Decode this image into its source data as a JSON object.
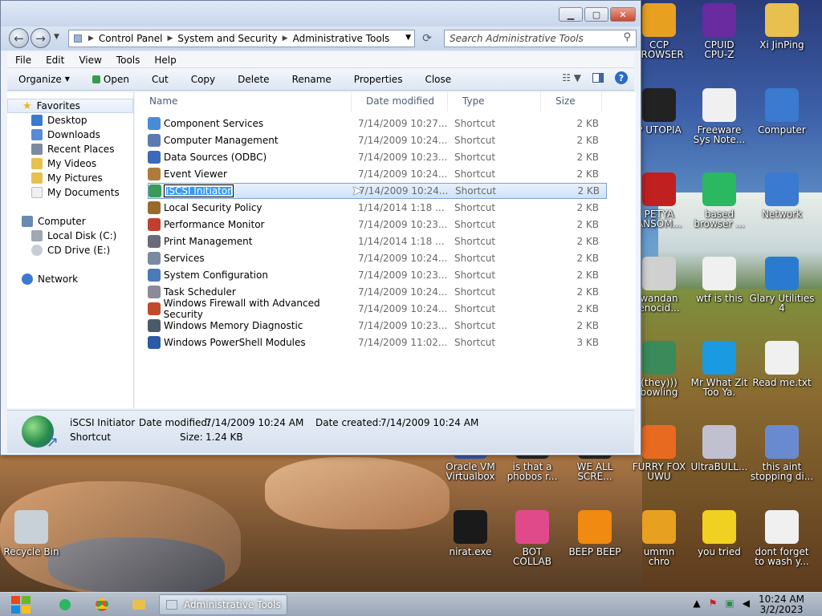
{
  "window": {
    "address": [
      "Control Panel",
      "System and Security",
      "Administrative Tools"
    ],
    "search_placeholder": "Search Administrative Tools"
  },
  "menu": [
    "File",
    "Edit",
    "View",
    "Tools",
    "Help"
  ],
  "toolbar": {
    "organize": "Organize",
    "open": "Open",
    "cut": "Cut",
    "copy": "Copy",
    "delete": "Delete",
    "rename": "Rename",
    "properties": "Properties",
    "close": "Close"
  },
  "nav": {
    "favorites": "Favorites",
    "desktop": "Desktop",
    "downloads": "Downloads",
    "recent": "Recent Places",
    "videos": "My Videos",
    "pictures": "My Pictures",
    "documents": "My Documents",
    "computer": "Computer",
    "localdisk": "Local Disk (C:)",
    "cddrive": "CD Drive (E:)",
    "network": "Network"
  },
  "columns": {
    "name": "Name",
    "date": "Date modified",
    "type": "Type",
    "size": "Size"
  },
  "files": [
    {
      "name": "Component Services",
      "date": "7/14/2009 10:27...",
      "type": "Shortcut",
      "size": "2 KB",
      "icon": "gear-icon",
      "color": "#4a8ad8"
    },
    {
      "name": "Computer Management",
      "date": "7/14/2009 10:24...",
      "type": "Shortcut",
      "size": "2 KB",
      "icon": "computer-icon",
      "color": "#5a7ab0"
    },
    {
      "name": "Data Sources (ODBC)",
      "date": "7/14/2009 10:23...",
      "type": "Shortcut",
      "size": "2 KB",
      "icon": "database-icon",
      "color": "#3a6ab8"
    },
    {
      "name": "Event Viewer",
      "date": "7/14/2009 10:24...",
      "type": "Shortcut",
      "size": "2 KB",
      "icon": "event-log-icon",
      "color": "#b07a3a"
    },
    {
      "name": "iSCSI Initiator",
      "date": "7/14/2009 10:24...",
      "type": "Shortcut",
      "size": "2 KB",
      "icon": "globe-icon",
      "color": "#3a9a5a"
    },
    {
      "name": "Local Security Policy",
      "date": "1/14/2014 1:18 ...",
      "type": "Shortcut",
      "size": "2 KB",
      "icon": "security-icon",
      "color": "#9a6a2a"
    },
    {
      "name": "Performance Monitor",
      "date": "7/14/2009 10:23...",
      "type": "Shortcut",
      "size": "2 KB",
      "icon": "monitor-icon",
      "color": "#c04030"
    },
    {
      "name": "Print Management",
      "date": "1/14/2014 1:18 ...",
      "type": "Shortcut",
      "size": "2 KB",
      "icon": "printer-icon",
      "color": "#6a6a7a"
    },
    {
      "name": "Services",
      "date": "7/14/2009 10:24...",
      "type": "Shortcut",
      "size": "2 KB",
      "icon": "gear-icon",
      "color": "#7a8aa0"
    },
    {
      "name": "System Configuration",
      "date": "7/14/2009 10:23...",
      "type": "Shortcut",
      "size": "2 KB",
      "icon": "config-icon",
      "color": "#4a7ab8"
    },
    {
      "name": "Task Scheduler",
      "date": "7/14/2009 10:24...",
      "type": "Shortcut",
      "size": "2 KB",
      "icon": "clock-icon",
      "color": "#8a8a9a"
    },
    {
      "name": "Windows Firewall with Advanced Security",
      "date": "7/14/2009 10:24...",
      "type": "Shortcut",
      "size": "2 KB",
      "icon": "firewall-icon",
      "color": "#c04a2a"
    },
    {
      "name": "Windows Memory Diagnostic",
      "date": "7/14/2009 10:23...",
      "type": "Shortcut",
      "size": "2 KB",
      "icon": "memory-icon",
      "color": "#4a5a6a"
    },
    {
      "name": "Windows PowerShell Modules",
      "date": "7/14/2009 11:02...",
      "type": "Shortcut",
      "size": "3 KB",
      "icon": "powershell-icon",
      "color": "#2a5aa8"
    }
  ],
  "details": {
    "name": "iSCSI Initiator",
    "type": "Shortcut",
    "modified_label": "Date modified:",
    "modified": "7/14/2009 10:24 AM",
    "created_label": "Date created:",
    "created": "7/14/2009 10:24 AM",
    "size_label": "Size:",
    "size": "1.24 KB"
  },
  "desktop": [
    {
      "label": "CCP\nBROWSER",
      "icon": "chrome-icon",
      "color": "#e8a020"
    },
    {
      "label": "CPUID\nCPU-Z",
      "icon": "cpuz-icon",
      "color": "#6a2aa0"
    },
    {
      "label": "Xi JinPing",
      "icon": "folder-user-icon",
      "color": "#e8c050"
    },
    {
      "label": "P UTOPIA",
      "icon": "utopia-icon",
      "color": "#222"
    },
    {
      "label": "Freeware\nSys Note...",
      "icon": "document-icon",
      "color": "#f0f0f0"
    },
    {
      "label": "Computer",
      "icon": "computer-icon",
      "color": "#3a7ad0"
    },
    {
      "label": "PETYA\nANSOM...",
      "icon": "skull-icon",
      "color": "#c02020"
    },
    {
      "label": "based\nbrowser ...",
      "icon": "chat-icon",
      "color": "#2ab860"
    },
    {
      "label": "Network",
      "icon": "network-icon",
      "color": "#3a7ad0"
    },
    {
      "label": "wandan\nenocid...",
      "icon": "meme-icon",
      "color": "#d0d0d0"
    },
    {
      "label": "wtf is this",
      "icon": "calendar-doc-icon",
      "color": "#f0f0f0"
    },
    {
      "label": "Glary Utilities\n4",
      "icon": "glary-icon",
      "color": "#2a7ad0"
    },
    {
      "label": "(they)))\nbowling",
      "icon": "clown-icon",
      "color": "#3a8a5a"
    },
    {
      "label": "Mr What Zit\nToo Ya.",
      "icon": "skype-icon",
      "color": "#1a9ae0"
    },
    {
      "label": "Read me.txt",
      "icon": "text-file-icon",
      "color": "#f0f0f0"
    },
    {
      "label": "Oracle VM\nVirtualbox",
      "icon": "virtualbox-icon",
      "color": "#3a5aa8"
    },
    {
      "label": "is that a\nphobos r...",
      "icon": "phobos-icon",
      "color": "#2a2a2a"
    },
    {
      "label": "WE ALL\nSCRE...",
      "icon": "scream-icon",
      "color": "#2a2a2a"
    },
    {
      "label": "FURRY FOX\nUWU",
      "icon": "firefox-icon",
      "color": "#e86a20"
    },
    {
      "label": "UltraBULL...",
      "icon": "disc-icon",
      "color": "#c0c0d0"
    },
    {
      "label": "this aint\nstopping di...",
      "icon": "installer-icon",
      "color": "#6a8ad0"
    },
    {
      "label": "Recycle Bin",
      "icon": "recycle-bin-icon",
      "color": "#c8d0d8"
    },
    {
      "label": "nirat.exe",
      "icon": "skull-icon",
      "color": "#1a1a1a"
    },
    {
      "label": "BOT\nCOLLAB",
      "icon": "bot-icon",
      "color": "#e04a8a"
    },
    {
      "label": "BEEP BEEP",
      "icon": "vlc-icon",
      "color": "#f08a10"
    },
    {
      "label": "ummn\nchro",
      "icon": "chrome-icon",
      "color": "#e8a020"
    },
    {
      "label": "you tried",
      "icon": "star-icon",
      "color": "#f0d020"
    },
    {
      "label": "dont forget\nto wash y...",
      "icon": "calendar-doc-icon",
      "color": "#f0f0f0"
    }
  ],
  "taskbar": {
    "active_task": "Administrative Tools",
    "time": "10:24 AM",
    "date": "3/2/2023"
  }
}
